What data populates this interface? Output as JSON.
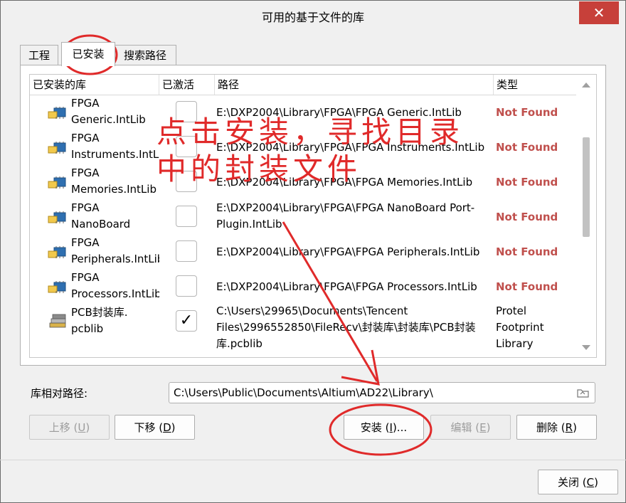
{
  "window": {
    "title": "可用的基于文件的库",
    "close_glyph": "✕"
  },
  "tabs": [
    {
      "label": "工程",
      "active": false
    },
    {
      "label": "已安装",
      "active": true
    },
    {
      "label": "搜索路径",
      "active": false
    }
  ],
  "table": {
    "headers": {
      "name": "已安装的库",
      "active": "已激活",
      "path": "路径",
      "type": "类型"
    },
    "rows": [
      {
        "name": "FPGA\nGeneric.IntLib",
        "active": false,
        "path": "E:\\DXP2004\\Library\\FPGA\\FPGA Generic.IntLib",
        "type": "Not Found",
        "icon": "library-chip-icon"
      },
      {
        "name": "FPGA\nInstruments.IntLib",
        "active": false,
        "path": "E:\\DXP2004\\Library\\FPGA\\FPGA Instruments.IntLib",
        "type": "Not Found",
        "icon": "library-chip-icon"
      },
      {
        "name": "FPGA\nMemories.IntLib",
        "active": false,
        "path": "E:\\DXP2004\\Library\\FPGA\\FPGA Memories.IntLib",
        "type": "Not Found",
        "icon": "library-chip-icon"
      },
      {
        "name": "FPGA\nNanoBoard",
        "active": false,
        "path": "E:\\DXP2004\\Library\\FPGA\\FPGA NanoBoard Port-Plugin.IntLib",
        "type": "Not Found",
        "icon": "library-chip-icon"
      },
      {
        "name": "FPGA\nPeripherals.IntLib",
        "active": false,
        "path": "E:\\DXP2004\\Library\\FPGA\\FPGA Peripherals.IntLib",
        "type": "Not Found",
        "icon": "library-chip-icon"
      },
      {
        "name": "FPGA\nProcessors.IntLib",
        "active": false,
        "path": "E:\\DXP2004\\Library\\FPGA\\FPGA Processors.IntLib",
        "type": "Not Found",
        "icon": "library-chip-icon"
      },
      {
        "name": "PCB封装库.\npcblib",
        "active": true,
        "path": "C:\\Users\\29965\\Documents\\Tencent Files\\2996552850\\FileRecv\\封装库\\封装库\\PCB封装库.pcblib",
        "type": "Protel Footprint Library",
        "icon": "footprint-library-icon"
      }
    ],
    "check_glyph": "✓"
  },
  "relative_path": {
    "label": "库相对路径:",
    "value": "C:\\Users\\Public\\Documents\\Altium\\AD22\\Library\\"
  },
  "buttons": {
    "move_up": {
      "label": "上移 (",
      "key": "U",
      "tail": ")"
    },
    "move_down": {
      "label": "下移 (",
      "key": "D",
      "tail": ")"
    },
    "install": {
      "label": "安装 (",
      "key": "I",
      "tail": ")..."
    },
    "edit": {
      "label": "编辑 (",
      "key": "E",
      "tail": ")"
    },
    "remove": {
      "label": "删除 (",
      "key": "R",
      "tail": ")"
    },
    "close": {
      "label": "关闭 (",
      "key": "C",
      "tail": ")"
    }
  },
  "annotation": {
    "text": "点击安装，寻找目录\n中的封装文件",
    "color": "#e02a2a"
  },
  "colors": {
    "not_found": "#c0504d",
    "annotation": "#e02a2a",
    "close_button": "#c7403a"
  }
}
